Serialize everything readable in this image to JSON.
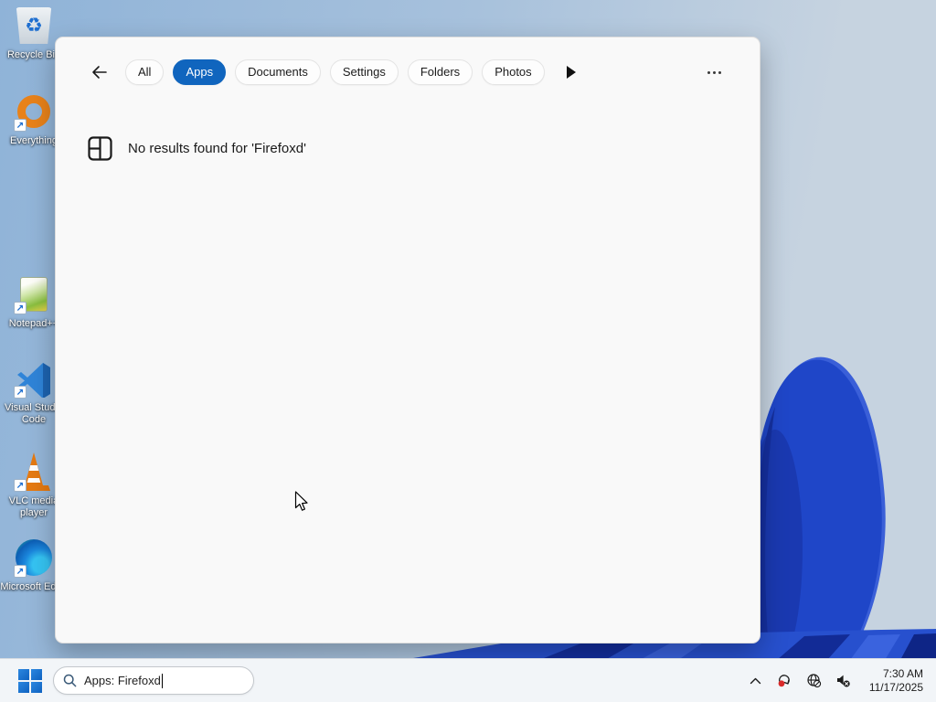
{
  "colors": {
    "accent": "#1065BE",
    "taskbar_bg": "#F2F5F8",
    "window_bg": "#F9F9F9",
    "wallpaper_left": "#8FB3D8",
    "wallpaper_right": "#C6D3E0",
    "bloom_primary": "#1F46C8",
    "bloom_dark": "#15309F",
    "bloom_light": "#3A5FD8",
    "badge_red": "#D92B2B"
  },
  "desktop": {
    "icons": [
      {
        "id": "recycle-bin",
        "label": "Recycle Bin"
      },
      {
        "id": "everything",
        "label": "Everything"
      },
      {
        "id": "notepad-plus-plus",
        "label": "Notepad++"
      },
      {
        "id": "visual-studio-code",
        "label": "Visual Studio Code"
      },
      {
        "id": "vlc-media-player",
        "label": "VLC media player"
      },
      {
        "id": "microsoft-edge",
        "label": "Microsoft Edge"
      }
    ]
  },
  "search_window": {
    "tabs": [
      {
        "label": "All"
      },
      {
        "label": "Apps"
      },
      {
        "label": "Documents"
      },
      {
        "label": "Settings"
      },
      {
        "label": "Folders"
      },
      {
        "label": "Photos"
      }
    ],
    "active_tab": "Apps",
    "no_results_text": "No results found for 'Firefoxd'"
  },
  "taskbar": {
    "search_value": "Apps: Firefoxd",
    "clock": {
      "time": "7:30 AM",
      "date": "11/17/2025"
    }
  }
}
